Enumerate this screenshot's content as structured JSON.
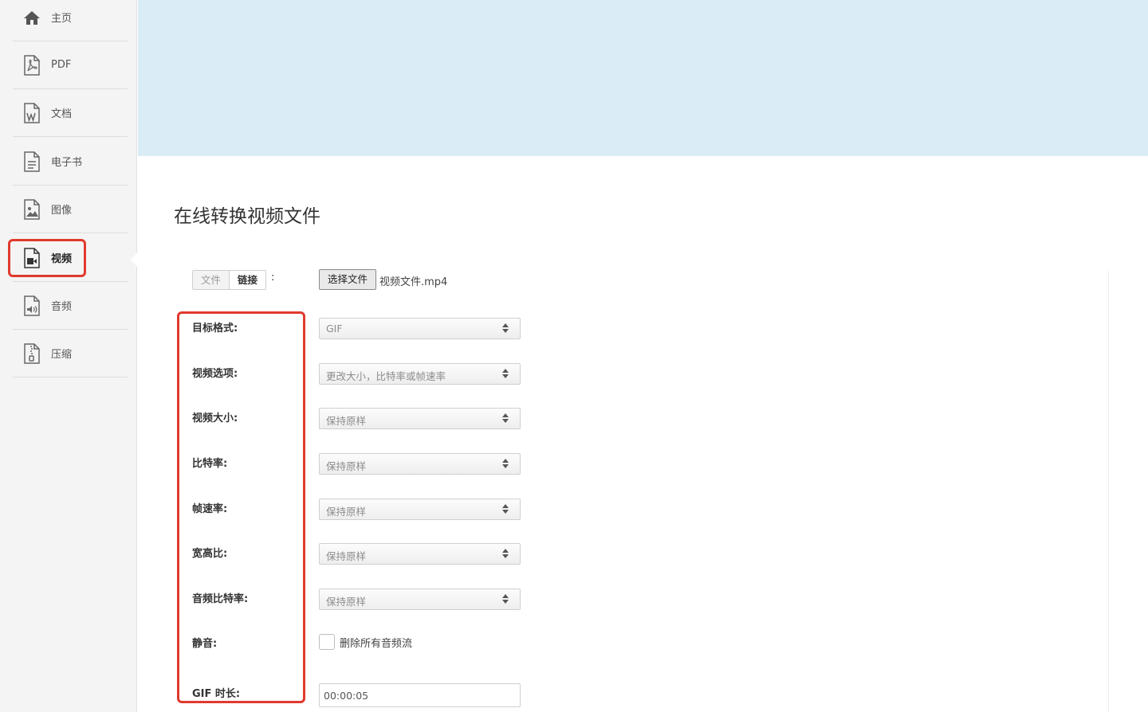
{
  "sidebar": {
    "items": [
      {
        "label": "主页",
        "icon": "home-icon"
      },
      {
        "label": "PDF",
        "icon": "pdf-file-icon"
      },
      {
        "label": "文档",
        "icon": "word-file-icon"
      },
      {
        "label": "电子书",
        "icon": "ebook-file-icon"
      },
      {
        "label": "图像",
        "icon": "image-file-icon"
      },
      {
        "label": "视频",
        "icon": "video-file-icon",
        "active": true
      },
      {
        "label": "音频",
        "icon": "audio-file-icon"
      },
      {
        "label": "压缩",
        "icon": "archive-file-icon"
      }
    ]
  },
  "main": {
    "title": "在线转换视频文件",
    "source_tabs": {
      "file": "文件",
      "link": "链接",
      "colon": ":"
    },
    "file_button": "选择文件",
    "file_name": "视频文件.mp4",
    "fields": {
      "target_format": {
        "label": "目标格式:",
        "value": "GIF"
      },
      "video_options": {
        "label": "视频选项:",
        "value": "更改大小，比特率或帧速率"
      },
      "video_size": {
        "label": "视频大小:",
        "value": "保持原样"
      },
      "bitrate": {
        "label": "比特率:",
        "value": "保持原样"
      },
      "frame_rate": {
        "label": "帧速率:",
        "value": "保持原样"
      },
      "aspect_ratio": {
        "label": "宽高比:",
        "value": "保持原样"
      },
      "audio_bitrate": {
        "label": "音频比特率:",
        "value": "保持原样"
      },
      "mute": {
        "label": "静音:",
        "checkbox_label": "删除所有音频流"
      },
      "gif_duration": {
        "label": "GIF 时长:",
        "value": "00:00:05"
      }
    }
  },
  "colors": {
    "banner": "#daedf6",
    "highlight": "#e03a2e",
    "sidebar_bg": "#f4f4f4"
  }
}
